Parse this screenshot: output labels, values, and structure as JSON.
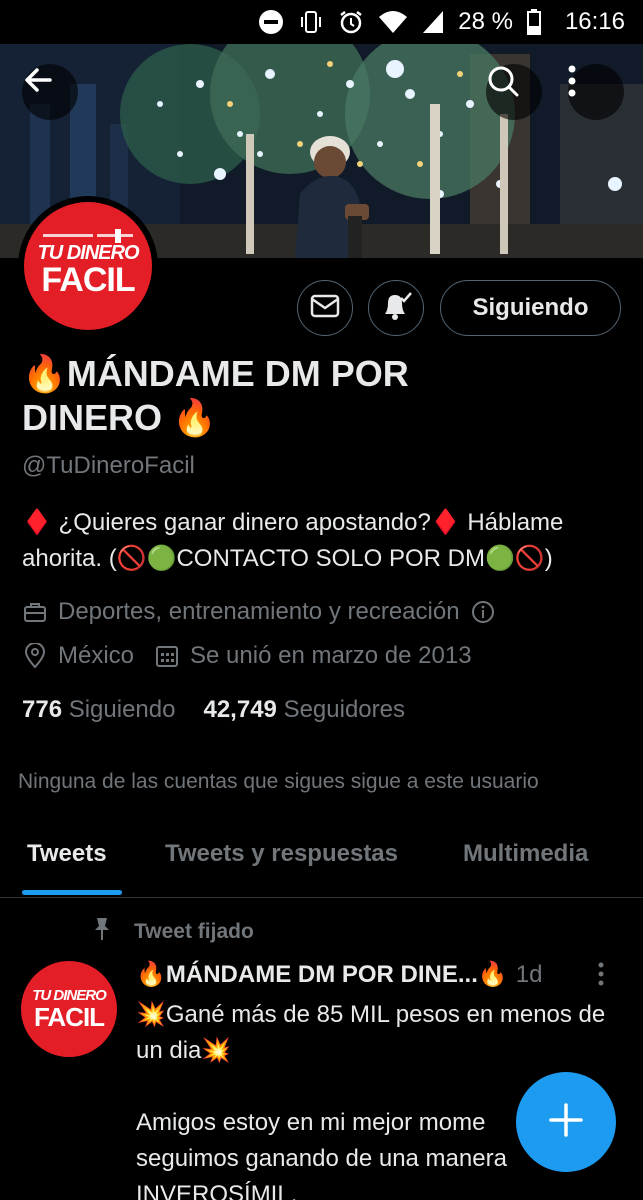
{
  "status_bar": {
    "battery": "28 %",
    "time": "16:16",
    "icons": [
      "do-not-disturb-icon",
      "vibrate-icon",
      "alarm-icon",
      "wifi-icon",
      "signal-icon",
      "battery-icon"
    ]
  },
  "header": {
    "back_icon": "back-arrow-icon",
    "search_icon": "search-icon",
    "more_icon": "more-vertical-icon"
  },
  "profile": {
    "avatar_text_line1": "TU DINERO",
    "avatar_text_line2": "FACIL",
    "name": "🔥MÁNDAME DM POR DINERO 🔥",
    "handle": "@TuDineroFacil",
    "bio": "♦️ ¿Quieres ganar dinero apostando?♦️ Háblame ahorita. (🚫🟢CONTACTO SOLO POR DM🟢🚫)",
    "category": "Deportes, entrenamiento y recreación",
    "location": "México",
    "joined": "Se unió en marzo de 2013",
    "following_count": "776",
    "following_label": "Siguiendo",
    "followers_count": "42,749",
    "followers_label": "Seguidores",
    "follow_button": "Siguiendo",
    "mutuals_notice": "Ninguna de las cuentas que sigues sigue a este usuario"
  },
  "tabs": [
    {
      "label": "Tweets",
      "active": true
    },
    {
      "label": "Tweets y respuestas",
      "active": false
    },
    {
      "label": "Multimedia",
      "active": false
    }
  ],
  "pinned_tweet": {
    "pinned_label": "Tweet fijado",
    "author": "🔥MÁNDAME DM POR DINE...🔥",
    "time": "1d",
    "line1": "💥Gané más de 85 MIL pesos en menos de un dia💥",
    "line2": "Amigos estoy en mi mejor mome",
    "line3": "seguimos ganando de una manera",
    "line4": "INVEROSÍMIL."
  },
  "colors": {
    "accent": "#1d9bf0",
    "background": "#000000",
    "text_primary": "#e7e9ea",
    "text_secondary": "#71767b",
    "avatar_red": "#e41e26"
  }
}
